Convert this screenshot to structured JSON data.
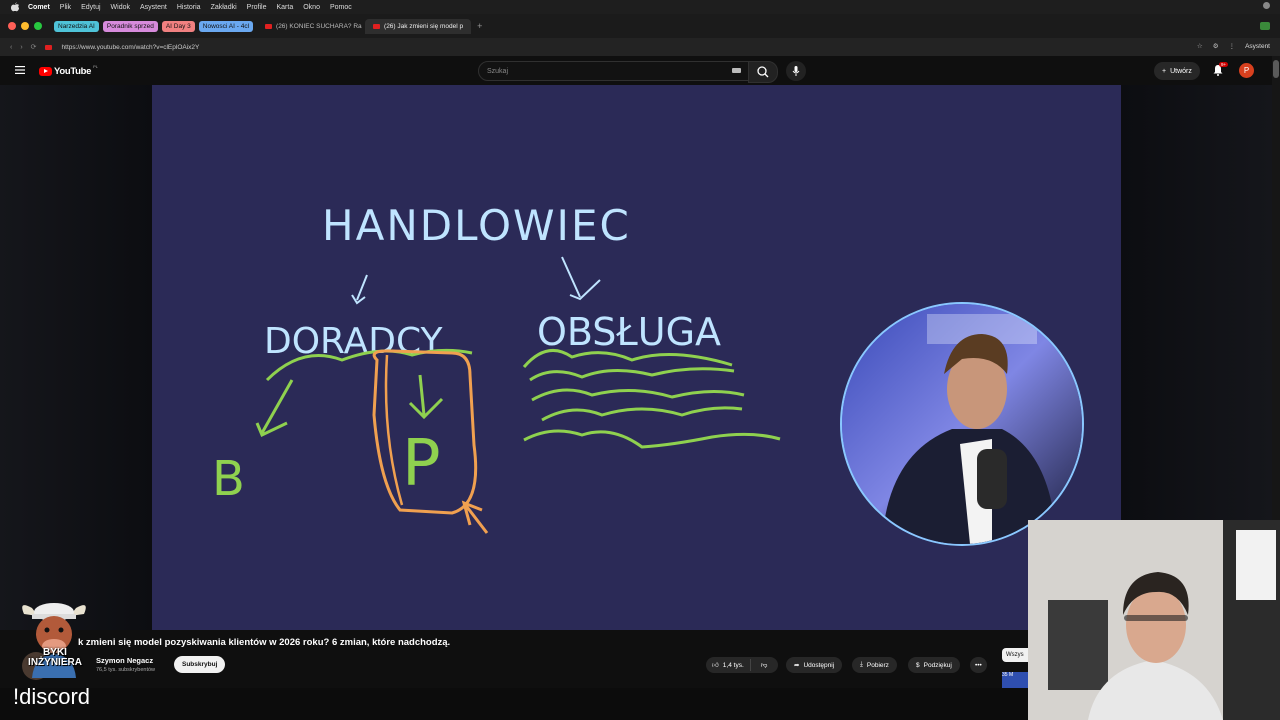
{
  "menubar": {
    "app": "Comet",
    "items": [
      "Plik",
      "Edytuj",
      "Widok",
      "Asystent",
      "Historia",
      "Zakładki",
      "Profile",
      "Karta",
      "Okno",
      "Pomoc"
    ]
  },
  "tabs": {
    "groups": [
      {
        "label": "Narzedzia AI",
        "color": "#4fc3d8"
      },
      {
        "label": "Poradnik sprzed",
        "color": "#d78bdc"
      },
      {
        "label": "AI Day 3",
        "color": "#f08080"
      },
      {
        "label": "Nowosci AI - 4cl",
        "color": "#6aa8f0"
      }
    ],
    "items": [
      {
        "label": "(26) KONIEC SUCHARA? Ra",
        "active": false
      },
      {
        "label": "(26) Jak zmieni się model p",
        "active": true
      }
    ]
  },
  "address": {
    "url": "https://www.youtube.com/watch?v=clEplOAix2Y",
    "assistant": "Asystent"
  },
  "youtube": {
    "logo": "YouTube",
    "region": "PL",
    "search_placeholder": "Szukaj",
    "create_label": "Utwórz",
    "notif_badge": "9+",
    "avatar_letter": "P"
  },
  "whiteboard": {
    "title": "HANDLOWIEC",
    "left_label": "DORADCY",
    "right_label": "OBSŁUGA",
    "letter_b": "B",
    "letter_p": "P"
  },
  "video": {
    "title": "k zmieni się model pozyskiwania klientów w 2026 roku? 6 zmian, które nadchodzą.",
    "channel": "Szymon Negacz",
    "subscribers": "76,5 tys. subskrybentów",
    "subscribe_label": "Subskrybuj",
    "likes": "1,4 tys.",
    "share_label": "Udostępnij",
    "download_label": "Pobierz",
    "thanks_label": "Podziękuj",
    "side_chip": "Wszys",
    "side_thumb_text": "35 M"
  },
  "overlay": {
    "streamer_logo": "BYKI INŻYNIERA",
    "command": "!discord"
  },
  "colors": {
    "board": "#2b2a57",
    "chalk_blue": "#bfe4ff",
    "chalk_green": "#8fd14f",
    "chalk_orange": "#f0a050",
    "accent": "#ff0000"
  }
}
